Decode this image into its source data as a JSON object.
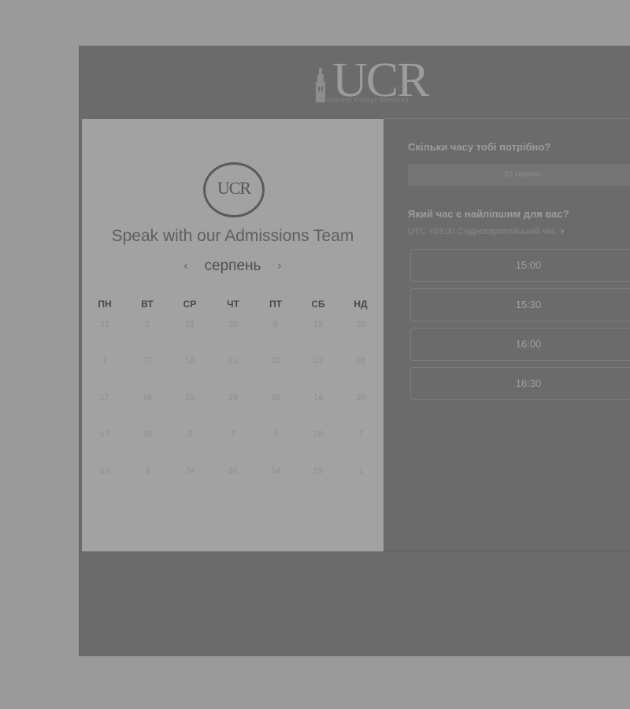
{
  "header": {
    "logo_text": "UCR",
    "logo_subtitle": "University College Roosevelt"
  },
  "calendar": {
    "logo_text": "UCR",
    "title": "Speak with our Admissions Team",
    "month": "серпень",
    "prev_icon": "chevron-left-icon",
    "next_icon": "chevron-right-icon",
    "weekdays": [
      "ПН",
      "ВТ",
      "СР",
      "ЧТ",
      "ПТ",
      "СБ",
      "НД"
    ],
    "weeks": [
      [
        "31",
        "2",
        "31",
        "20",
        "6",
        "13",
        "20"
      ],
      [
        "1",
        "27",
        "18",
        "21",
        "22",
        "22",
        "26"
      ],
      [
        "17",
        "16",
        "16",
        "19",
        "26",
        "14",
        "26"
      ],
      [
        "17",
        "20",
        "2",
        "7",
        "1",
        "26",
        "7"
      ],
      [
        "13",
        "3",
        "24",
        "30",
        "14",
        "19",
        "1"
      ]
    ]
  },
  "booking": {
    "duration_question": "Скільки часу тобі потрібно?",
    "duration_value": "30 хвилин",
    "time_question": "Який час є найліпшим для вас?",
    "timezone": "UTC +03:00 Східноєвропейський час",
    "timezone_icon": "caret-down-icon",
    "slots": [
      "15:00",
      "15:30",
      "16:00",
      "16:30"
    ]
  }
}
